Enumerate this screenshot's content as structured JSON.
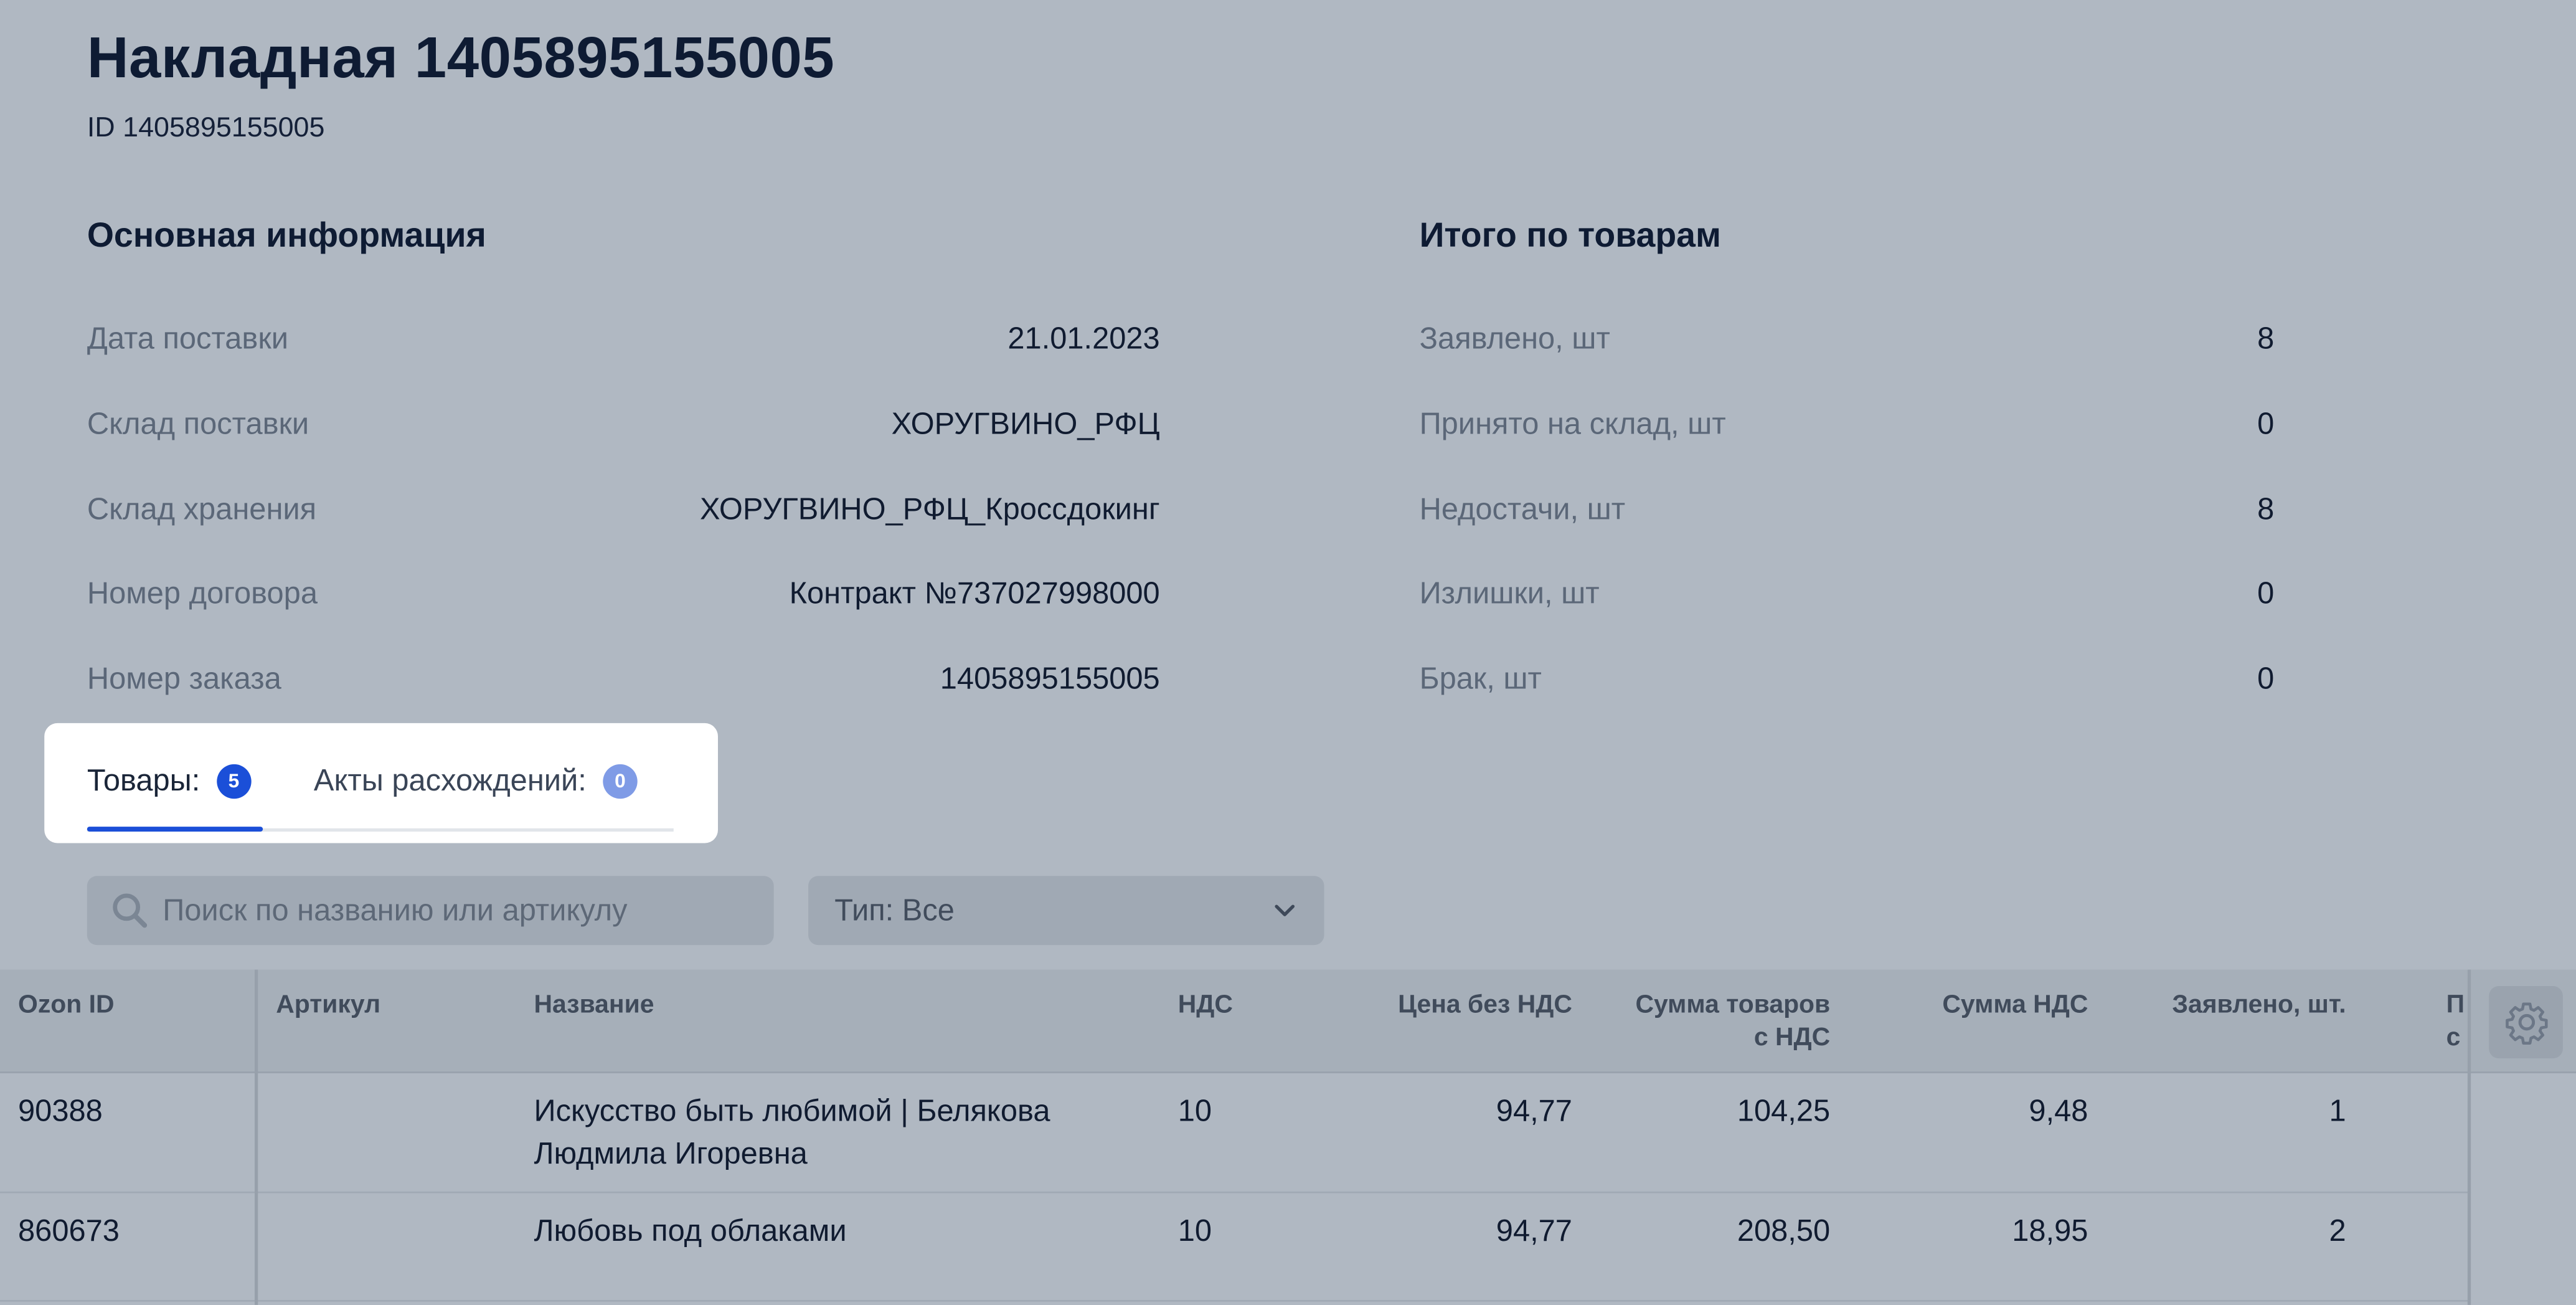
{
  "header": {
    "title": "Накладная 1405895155005",
    "subtitle": "ID 1405895155005"
  },
  "main_info": {
    "heading": "Основная информация",
    "rows": [
      {
        "label": "Дата поставки",
        "value": "21.01.2023"
      },
      {
        "label": "Склад поставки",
        "value": "ХОРУГВИНО_РФЦ"
      },
      {
        "label": "Склад хранения",
        "value": "ХОРУГВИНО_РФЦ_Кроссдокинг"
      },
      {
        "label": "Номер договора",
        "value": "Контракт №737027998000"
      },
      {
        "label": "Номер заказа",
        "value": "1405895155005"
      }
    ]
  },
  "totals": {
    "heading": "Итого по товарам",
    "rows": [
      {
        "label": "Заявлено, шт",
        "value": "8"
      },
      {
        "label": "Принято на склад, шт",
        "value": "0"
      },
      {
        "label": "Недостачи, шт",
        "value": "8"
      },
      {
        "label": "Излишки, шт",
        "value": "0"
      },
      {
        "label": "Брак, шт",
        "value": "0"
      }
    ]
  },
  "tabs": [
    {
      "label": "Товары:",
      "count": "5",
      "active": true
    },
    {
      "label": "Акты расхождений:",
      "count": "0",
      "active": false
    }
  ],
  "filters": {
    "search_placeholder": "Поиск по названию или артикулу",
    "type_select": "Тип: Все"
  },
  "table": {
    "columns": {
      "ozon_id": "Ozon ID",
      "article": "Артикул",
      "name": "Название",
      "vat": "НДС",
      "price_no_vat": "Цена без НДС",
      "sum_with_vat_1": "Сумма товаров",
      "sum_with_vat_2": "с НДС",
      "vat_sum": "Сумма НДС",
      "declared": "Заявлено, шт.",
      "clipped_1": "П",
      "clipped_2": "с"
    },
    "rows": [
      {
        "ozon_id": "90388",
        "article": "",
        "name_line1": "Искусство быть любимой | Белякова",
        "name_line2": "Людмила Игоревна",
        "vat": "10",
        "price_no_vat": "94,77",
        "sum_with_vat": "104,25",
        "vat_sum": "9,48",
        "declared": "1"
      },
      {
        "ozon_id": "860673",
        "article": "",
        "name_line1": "Любовь под облаками",
        "name_line2": "",
        "vat": "10",
        "price_no_vat": "94,77",
        "sum_with_vat": "208,50",
        "vat_sum": "18,95",
        "declared": "2"
      }
    ]
  },
  "icons": {
    "search": "search-icon",
    "chevron": "chevron-down-icon",
    "settings": "gear-icon"
  },
  "colors": {
    "background": "#b0b8c2",
    "accent": "#1b4fd8",
    "badge_inactive": "#7f9be6",
    "panel": "#ffffff"
  }
}
